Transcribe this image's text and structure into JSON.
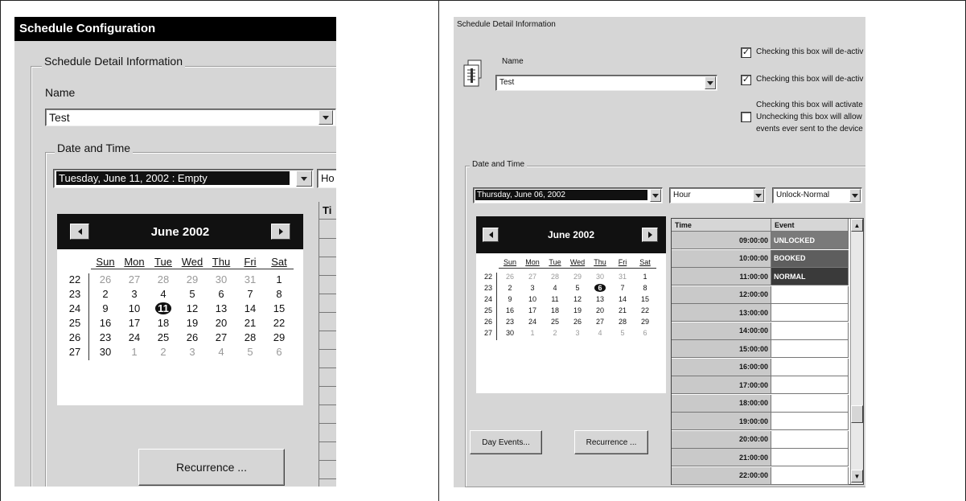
{
  "left": {
    "title": "Schedule Configuration",
    "group_label": "Schedule Detail Information",
    "name_label": "Name",
    "name_value": "Test",
    "datetime_label": "Date and Time",
    "date_value": "Tuesday, June 11, 2002 : Empty",
    "mode_value": "Ho",
    "table_header": "Ti",
    "calendar": {
      "month_year": "June 2002",
      "weekdays": [
        "Sun",
        "Mon",
        "Tue",
        "Wed",
        "Thu",
        "Fri",
        "Sat"
      ],
      "weeks": [
        {
          "num": "22",
          "days": [
            "26",
            "27",
            "28",
            "29",
            "30",
            "31",
            "1"
          ]
        },
        {
          "num": "23",
          "days": [
            "2",
            "3",
            "4",
            "5",
            "6",
            "7",
            "8"
          ]
        },
        {
          "num": "24",
          "days": [
            "9",
            "10",
            "11",
            "12",
            "13",
            "14",
            "15"
          ]
        },
        {
          "num": "25",
          "days": [
            "16",
            "17",
            "18",
            "19",
            "20",
            "21",
            "22"
          ]
        },
        {
          "num": "26",
          "days": [
            "23",
            "24",
            "25",
            "26",
            "27",
            "28",
            "29"
          ]
        },
        {
          "num": "27",
          "days": [
            "30",
            "1",
            "2",
            "3",
            "4",
            "5",
            "6"
          ]
        }
      ],
      "selected_day": "11"
    },
    "recurrence_button": "Recurrence ..."
  },
  "right": {
    "group_label": "Schedule Detail Information",
    "name_label": "Name",
    "name_value": "Test",
    "checkboxes": [
      {
        "checked": true,
        "label": "Checking this box will de-activ"
      },
      {
        "checked": true,
        "label": "Checking this box will de-activ"
      },
      {
        "checked": false,
        "label_lines": [
          "Checking this box will activate",
          "Unchecking this box will allow",
          "events ever sent to the device"
        ]
      }
    ],
    "datetime_label": "Date and Time",
    "date_value": "Thursday, June 06, 2002",
    "interval_value": "Hour",
    "event_type_value": "Unlock-Normal",
    "calendar": {
      "month_year": "June 2002",
      "weekdays": [
        "Sun",
        "Mon",
        "Tue",
        "Wed",
        "Thu",
        "Fri",
        "Sat"
      ],
      "weeks": [
        {
          "num": "22",
          "days": [
            "26",
            "27",
            "28",
            "29",
            "30",
            "31",
            "1"
          ]
        },
        {
          "num": "23",
          "days": [
            "2",
            "3",
            "4",
            "5",
            "6",
            "7",
            "8"
          ]
        },
        {
          "num": "24",
          "days": [
            "9",
            "10",
            "11",
            "12",
            "13",
            "14",
            "15"
          ]
        },
        {
          "num": "25",
          "days": [
            "16",
            "17",
            "18",
            "19",
            "20",
            "21",
            "22"
          ]
        },
        {
          "num": "26",
          "days": [
            "23",
            "24",
            "25",
            "26",
            "27",
            "28",
            "29"
          ]
        },
        {
          "num": "27",
          "days": [
            "30",
            "1",
            "2",
            "3",
            "4",
            "5",
            "6"
          ]
        }
      ],
      "selected_day": "6"
    },
    "table": {
      "headers": [
        "Time",
        "Event"
      ],
      "rows": [
        {
          "time": "09:00:00",
          "event": "UNLOCKED",
          "shade": "#7a7a7a"
        },
        {
          "time": "10:00:00",
          "event": "BOOKED",
          "shade": "#5e5e5e"
        },
        {
          "time": "11:00:00",
          "event": "NORMAL",
          "shade": "#3a3a3a"
        },
        {
          "time": "12:00:00",
          "event": ""
        },
        {
          "time": "13:00:00",
          "event": ""
        },
        {
          "time": "14:00:00",
          "event": ""
        },
        {
          "time": "15:00:00",
          "event": ""
        },
        {
          "time": "16:00:00",
          "event": ""
        },
        {
          "time": "17:00:00",
          "event": ""
        },
        {
          "time": "18:00:00",
          "event": ""
        },
        {
          "time": "19:00:00",
          "event": ""
        },
        {
          "time": "20:00:00",
          "event": ""
        },
        {
          "time": "21:00:00",
          "event": ""
        },
        {
          "time": "22:00:00",
          "event": ""
        }
      ]
    },
    "day_events_button": "Day Events...",
    "recurrence_button": "Recurrence ..."
  }
}
